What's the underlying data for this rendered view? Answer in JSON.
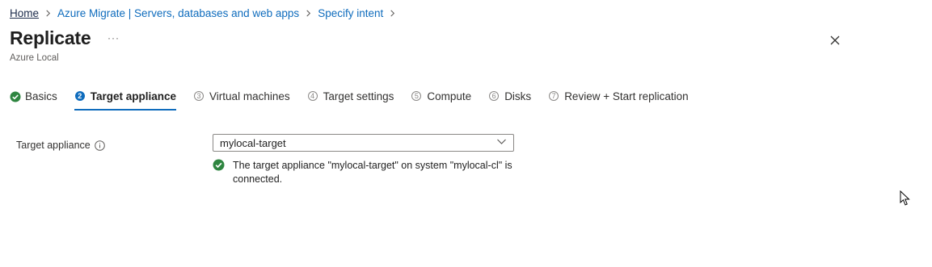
{
  "breadcrumb": {
    "home": "Home",
    "items": [
      "Azure Migrate | Servers, databases and web apps",
      "Specify intent"
    ]
  },
  "header": {
    "title": "Replicate",
    "more": "···",
    "subtitle": "Azure Local"
  },
  "tabs": [
    {
      "label": "Basics",
      "state": "done"
    },
    {
      "label": "Target appliance",
      "number": "2",
      "state": "active"
    },
    {
      "label": "Virtual machines",
      "number": "3",
      "state": "pending"
    },
    {
      "label": "Target settings",
      "number": "4",
      "state": "pending"
    },
    {
      "label": "Compute",
      "number": "5",
      "state": "pending"
    },
    {
      "label": "Disks",
      "number": "6",
      "state": "pending"
    },
    {
      "label": "Review + Start replication",
      "number": "7",
      "state": "pending"
    }
  ],
  "form": {
    "target_appliance_label": "Target appliance",
    "target_appliance_value": "mylocal-target",
    "status_message": "The target appliance \"mylocal-target\" on system \"mylocal-cl\" is connected."
  },
  "colors": {
    "accent": "#0f6cbd",
    "success": "#2e8540"
  },
  "icons": [
    "chevron-right-icon",
    "more-icon",
    "close-icon",
    "check-circle-icon",
    "info-icon",
    "chevron-down-icon",
    "success-icon",
    "mouse-cursor-icon"
  ]
}
